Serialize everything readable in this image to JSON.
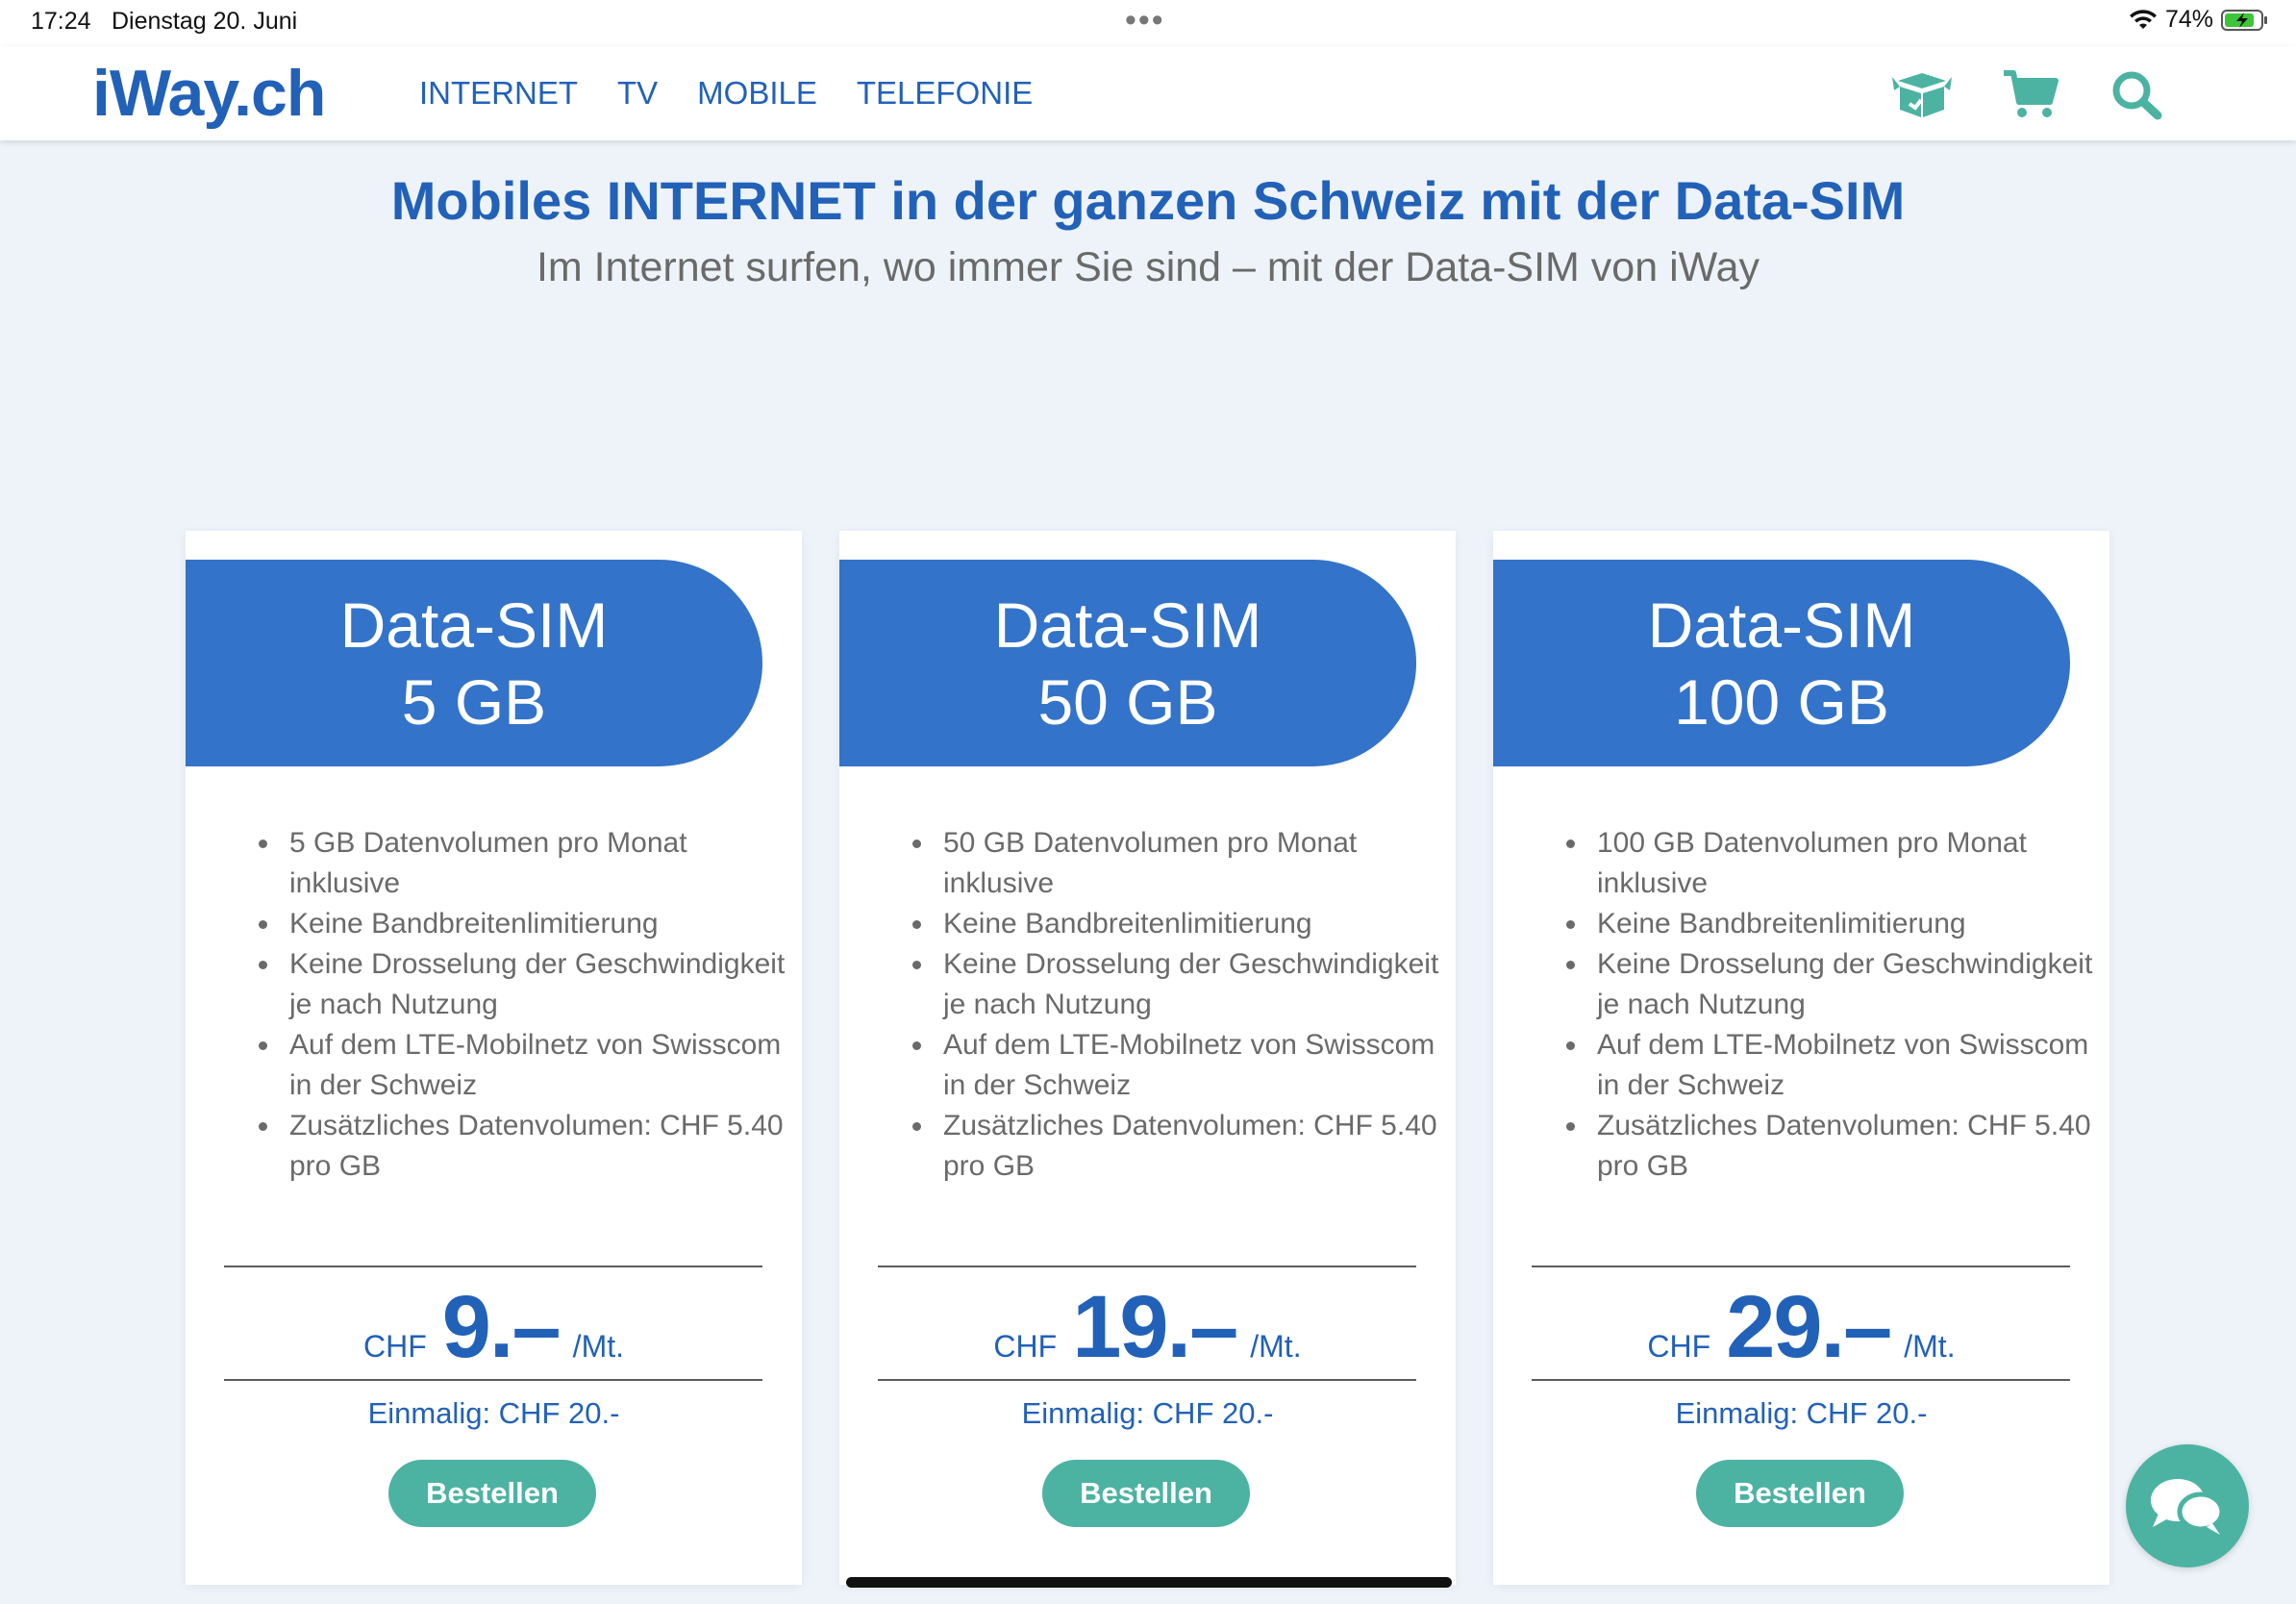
{
  "status_bar": {
    "time": "17:24",
    "date": "Dienstag 20. Juni",
    "battery": "74%"
  },
  "nav": {
    "logo": "iWay.ch",
    "links": [
      "INTERNET",
      "TV",
      "MOBILE",
      "TELEFONIE"
    ],
    "icons": [
      "box-icon",
      "cart-icon",
      "search-icon"
    ]
  },
  "hero": {
    "title": "Mobiles INTERNET in der ganzen Schweiz mit der Data-SIM",
    "subtitle": "Im Internet surfen, wo immer Sie sind – mit der Data-SIM von iWay"
  },
  "plans": [
    {
      "name": "Data-SIM",
      "volume": "5 GB",
      "features": [
        "5 GB Datenvolumen pro Monat inklusive",
        "Keine Bandbreitenlimitierung",
        "Keine Drosselung der Geschwindigkeit je nach Nutzung",
        "Auf dem LTE-Mobilnetz von Swisscom in der Schweiz",
        "Zusätzliches Datenvolumen: CHF 5.40 pro GB"
      ],
      "currency": "CHF",
      "price": "9.–",
      "period": "/Mt.",
      "one_time": "Einmalig: CHF 20.-",
      "button": "Bestellen"
    },
    {
      "name": "Data-SIM",
      "volume": "50 GB",
      "features": [
        "50 GB Datenvolumen pro Monat inklusive",
        "Keine Bandbreitenlimitierung",
        "Keine Drosselung der Geschwindigkeit je nach Nutzung",
        "Auf dem LTE-Mobilnetz von Swisscom in der Schweiz",
        "Zusätzliches Datenvolumen: CHF 5.40 pro GB"
      ],
      "currency": "CHF",
      "price": "19.–",
      "period": "/Mt.",
      "one_time": "Einmalig: CHF 20.-",
      "button": "Bestellen"
    },
    {
      "name": "Data-SIM",
      "volume": "100 GB",
      "features": [
        "100 GB Datenvolumen pro Monat inklusive",
        "Keine Bandbreitenlimitierung",
        "Keine Drosselung der Geschwindigkeit je nach Nutzung",
        "Auf dem LTE-Mobilnetz von Swisscom in der Schweiz",
        "Zusätzliches Datenvolumen: CHF 5.40 pro GB"
      ],
      "currency": "CHF",
      "price": "29.–",
      "period": "/Mt.",
      "one_time": "Einmalig: CHF 20.-",
      "button": "Bestellen"
    }
  ],
  "colors": {
    "brand_blue": "#2261b8",
    "card_header": "#3373c9",
    "accent_teal": "#4cb3a2",
    "background": "#edf3f8"
  }
}
